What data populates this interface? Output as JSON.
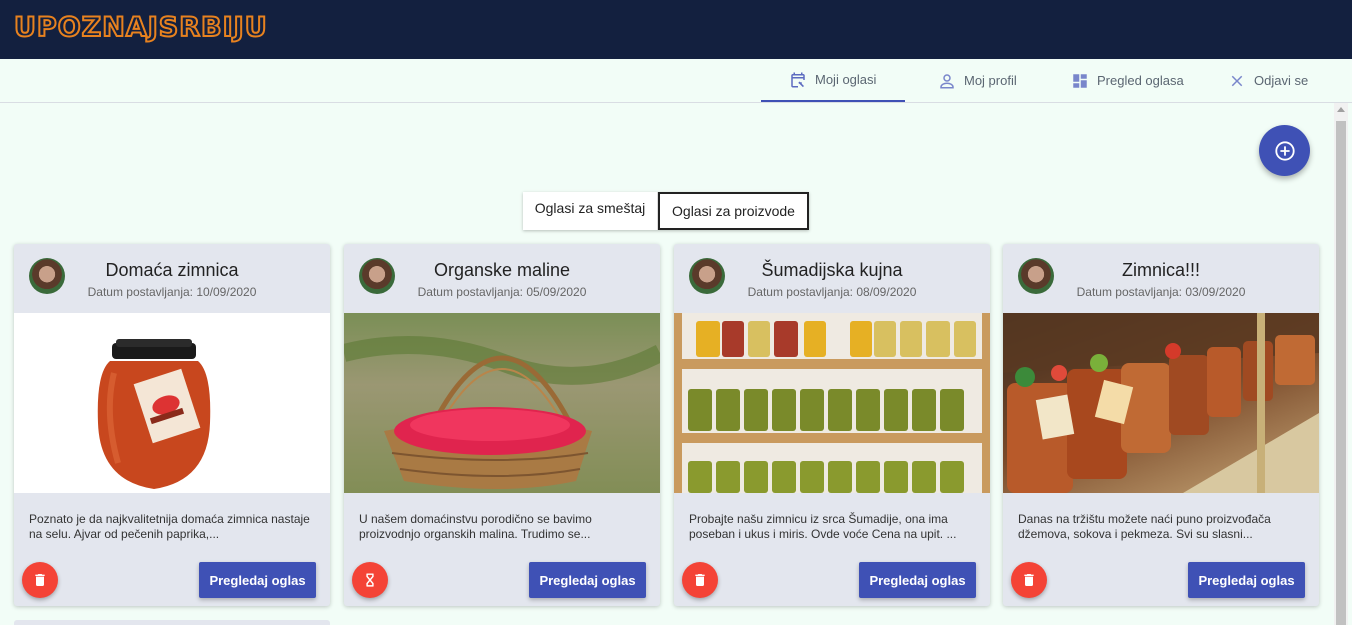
{
  "header": {
    "logo_text": "UPOZNAJSRBIJU"
  },
  "nav": [
    {
      "label": "Moji oglasi",
      "icon": "calendar-edit-icon",
      "active": true
    },
    {
      "label": "Moj profil",
      "icon": "person-icon"
    },
    {
      "label": "Pregled oglasa",
      "icon": "dashboard-icon"
    },
    {
      "label": "Odjavi se",
      "icon": "close-icon"
    }
  ],
  "fab": {
    "icon": "add-circle-icon"
  },
  "toggle": {
    "accommodation": "Oglasi za smeštaj",
    "products": "Oglasi za proizvode",
    "selected": "products"
  },
  "cards": [
    {
      "title": "Domaća zimnica",
      "date": "Datum postavljanja: 10/09/2020",
      "description": "Poznato je da najkvalitetnija domaća zimnica nastaje na selu. Ajvar od pečenih paprika,...",
      "action_icon": "trash-icon",
      "button": "Pregledaj oglas"
    },
    {
      "title": "Organske maline",
      "date": "Datum postavljanja: 05/09/2020",
      "description": "U našem domaćinstvu porodično se bavimo proizvodnjo organskih malina. Trudimo se...",
      "action_icon": "hourglass-icon",
      "button": "Pregledaj oglas"
    },
    {
      "title": "Šumadijska kujna",
      "date": "Datum postavljanja: 08/09/2020",
      "description": "Probajte našu zimnicu iz srca Šumadije, ona ima poseban i ukus i miris. Ovde voće Cena na upit. ...",
      "action_icon": "trash-icon",
      "button": "Pregledaj oglas"
    },
    {
      "title": "Zimnica!!!",
      "date": "Datum postavljanja: 03/09/2020",
      "description": "Danas na tržištu možete naći puno proizvođača džemova, sokova i pekmeza. Svi su slasni...",
      "action_icon": "trash-icon",
      "button": "Pregledaj oglas"
    }
  ],
  "colors": {
    "primary": "#3f51b5",
    "danger": "#f44336",
    "header_bg": "#13203f",
    "logo": "#e8821f"
  }
}
